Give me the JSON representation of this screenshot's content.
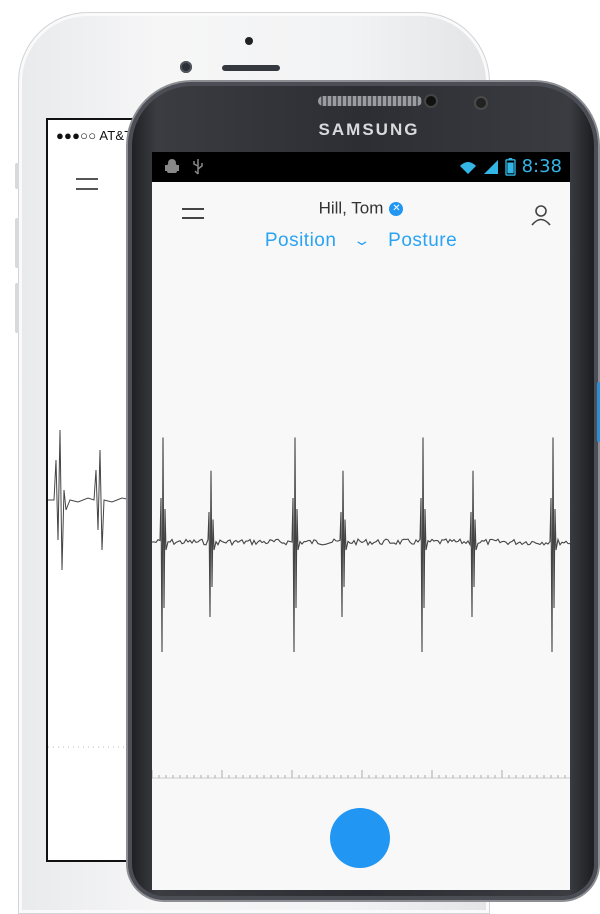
{
  "back_phone": {
    "status_text": "●●●○○ AT&T",
    "icons": [
      "menu-icon"
    ]
  },
  "front_phone": {
    "brand": "SAMSUNG",
    "status_bar": {
      "time": "8:38",
      "left_icons": [
        "android-debug-icon",
        "usb-icon"
      ],
      "right_icons": [
        "wifi-icon",
        "signal-icon",
        "battery-icon"
      ]
    },
    "header": {
      "patient_name": "Hill, Tom",
      "clear_icon": "close-circle-icon",
      "profile_icon": "person-icon",
      "menu_icon": "menu-icon"
    },
    "tabs": {
      "position": "Position",
      "posture": "Posture",
      "dropdown_icon": "chevron-down-icon"
    },
    "record_button_color": "#2196f3"
  },
  "colors": {
    "accent": "#2aa3f3",
    "status_blue": "#33b5e5",
    "waveform": "#444444"
  }
}
